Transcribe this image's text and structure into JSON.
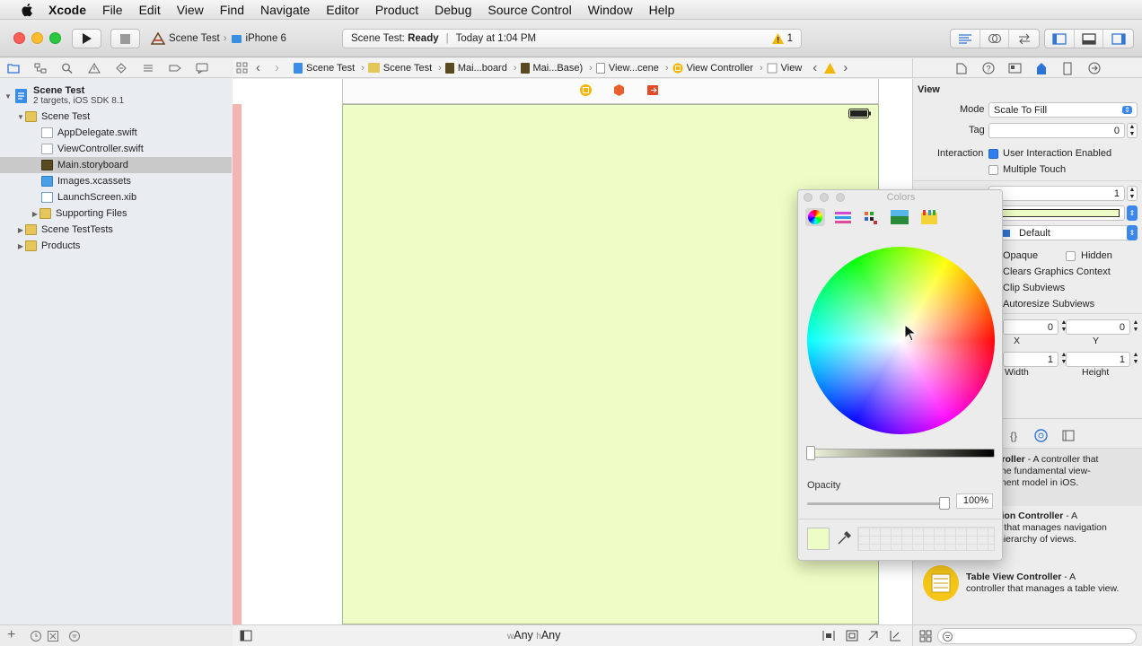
{
  "menubar": {
    "app": "Xcode",
    "items": [
      "File",
      "Edit",
      "View",
      "Find",
      "Navigate",
      "Editor",
      "Product",
      "Debug",
      "Source Control",
      "Window",
      "Help"
    ]
  },
  "toolbar": {
    "scheme": "Scene Test",
    "device": "iPhone 6",
    "status_project": "Scene Test:",
    "status_state": "Ready",
    "status_time": "Today at 1:04 PM",
    "warning_count": "1"
  },
  "navigator": {
    "project_name": "Scene Test",
    "project_sub": "2 targets, iOS SDK 8.1",
    "items": [
      {
        "label": "Scene Test",
        "kind": "folder",
        "disclosure": "open"
      },
      {
        "label": "AppDelegate.swift",
        "kind": "swift"
      },
      {
        "label": "ViewController.swift",
        "kind": "swift"
      },
      {
        "label": "Main.storyboard",
        "kind": "storyboard",
        "selected": true
      },
      {
        "label": "Images.xcassets",
        "kind": "assets"
      },
      {
        "label": "LaunchScreen.xib",
        "kind": "xib"
      },
      {
        "label": "Supporting Files",
        "kind": "folder",
        "disclosure": "closed"
      },
      {
        "label": "Scene TestTests",
        "kind": "folder",
        "disclosure": "closed"
      },
      {
        "label": "Products",
        "kind": "folder",
        "disclosure": "closed"
      }
    ]
  },
  "jumpbar": {
    "crumbs": [
      "Scene Test",
      "Scene Test",
      "Mai...board",
      "Mai...Base)",
      "View...cene",
      "View Controller",
      "View"
    ]
  },
  "canvas": {
    "view_color": "#eefcc5",
    "size_w_prefix": "w",
    "size_w": "Any",
    "size_h_prefix": "h",
    "size_h": "Any"
  },
  "inspector": {
    "section": "View",
    "mode_label": "Mode",
    "mode_value": "Scale To Fill",
    "tag_label": "Tag",
    "tag_value": "0",
    "interaction_label": "Interaction",
    "user_interaction": "User Interaction Enabled",
    "multiple_touch": "Multiple Touch",
    "alpha_value": "1",
    "tint_value": "Default",
    "opaque": "Opaque",
    "hidden": "Hidden",
    "clears": "Clears Graphics Context",
    "clip": "Clip Subviews",
    "autoresize": "Autoresize Subviews",
    "x_value": "0",
    "y_value": "0",
    "x_label": "X",
    "y_label": "Y",
    "w_value": "1",
    "h_value": "1",
    "w_label": "Width",
    "h_label": "Height",
    "library": [
      {
        "title": "troller",
        "desc1": " - A controller that",
        "desc2": "the fundamental view-",
        "desc3": "ment model in iOS."
      },
      {
        "title": "tion Controller",
        "desc1": " - A",
        "desc2": "r that manages navigation",
        "desc3": "hierarchy of views."
      },
      {
        "title": "Table View Controller",
        "desc1": " - A",
        "desc2": "controller that manages a table view.",
        "desc3": ""
      }
    ]
  },
  "colors_panel": {
    "title": "Colors",
    "opacity_label": "Opacity",
    "opacity_value": "100%",
    "opacity_level": 1.0
  }
}
